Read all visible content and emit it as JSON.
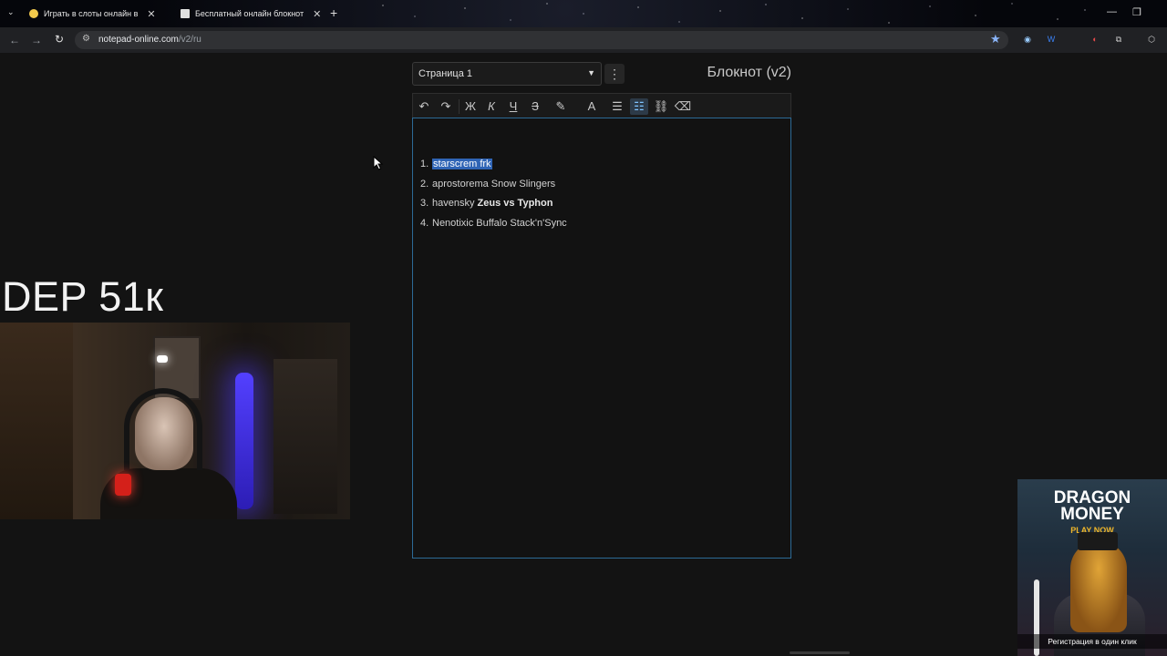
{
  "browser": {
    "tabs": [
      {
        "title": "Играть в слоты онлайн в",
        "favicon_color": "#f2c94c"
      },
      {
        "title": "Бесплатный онлайн блокнот",
        "favicon_color": "#e0e0e0"
      }
    ],
    "url_host": "notepad-online.com",
    "url_path": "/v2/ru"
  },
  "notepad": {
    "page_select": "Страница 1",
    "title": "Блокнот (v2)",
    "toolbar": {
      "undo": "↶",
      "redo": "↷",
      "bold": "Ж",
      "italic": "К",
      "underline": "Ч",
      "strike": "З",
      "highlight": "✎",
      "font_color": "A",
      "bullet_list": "☰",
      "numbered_list": "☷",
      "link": "⛓",
      "clear": "⌫"
    },
    "list": [
      {
        "num": "1.",
        "plain": "",
        "selected": "starscrem frk",
        "bold": ""
      },
      {
        "num": "2.",
        "plain": "aprostorema Snow Slingers",
        "selected": "",
        "bold": ""
      },
      {
        "num": "3.",
        "plain": "havensky ",
        "selected": "",
        "bold": "Zeus vs Typhon"
      },
      {
        "num": "4.",
        "plain": "Nenotixic Buffalo Stack'n'Sync",
        "selected": "",
        "bold": ""
      }
    ]
  },
  "overlay": {
    "dep_text": "DEP 51к",
    "ad": {
      "title_line1": "DRAGON",
      "title_line2": "MONEY",
      "play_now": "PLAY NOW",
      "caption": "Регистрация в один клик"
    }
  }
}
